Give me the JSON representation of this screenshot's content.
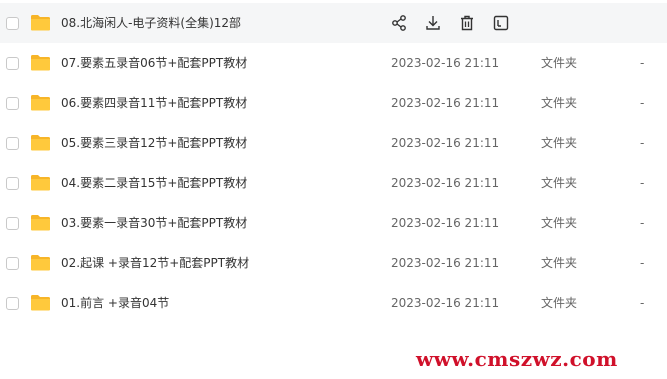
{
  "files": [
    {
      "name": "08.北海闲人-电子资料(全集)12部",
      "time": "",
      "type": "",
      "size": ""
    },
    {
      "name": "07.要素五录音06节+配套PPT教材",
      "time": "2023-02-16 21:11",
      "type": "文件夹",
      "size": "-"
    },
    {
      "name": "06.要素四录音11节+配套PPT教材",
      "time": "2023-02-16 21:11",
      "type": "文件夹",
      "size": "-"
    },
    {
      "name": "05.要素三录音12节+配套PPT教材",
      "time": "2023-02-16 21:11",
      "type": "文件夹",
      "size": "-"
    },
    {
      "name": "04.要素二录音15节+配套PPT教材",
      "time": "2023-02-16 21:11",
      "type": "文件夹",
      "size": "-"
    },
    {
      "name": "03.要素一录音30节+配套PPT教材",
      "time": "2023-02-16 21:11",
      "type": "文件夹",
      "size": "-"
    },
    {
      "name": "02.起课 +录音12节+配套PPT教材",
      "time": "2023-02-16 21:11",
      "type": "文件夹",
      "size": "-"
    },
    {
      "name": "01.前言 +录音04节",
      "time": "2023-02-16 21:11",
      "type": "文件夹",
      "size": "-"
    }
  ],
  "row_actions": [
    "share-icon",
    "download-icon",
    "delete-icon",
    "rename-icon"
  ],
  "colors": {
    "folder": "#ffc93c",
    "folder_dark": "#f7b528",
    "hover_row": "#f5f6f7",
    "icon": "#333333",
    "watermark": "#d0102a"
  },
  "watermark": "www.cmszwz.com"
}
